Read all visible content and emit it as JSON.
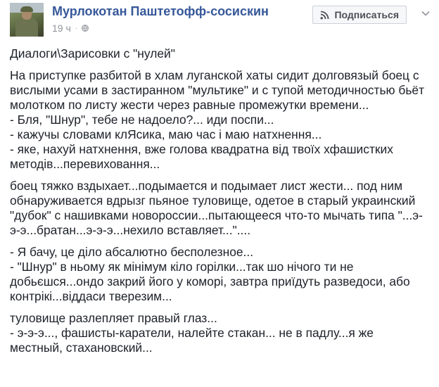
{
  "post": {
    "author": "Мурлокотан Паштетофф-сосискин",
    "time": "19 ч",
    "privacy_icon": "globe-icon",
    "follow_label": "Подписаться",
    "follow_icon": "rss-icon",
    "menu_icon": "chevron-down-icon"
  },
  "paragraphs": [
    {
      "lines": [
        "Диалоги\\Зарисовки с \"нулей\""
      ]
    },
    {
      "lines": [
        "На приступке разбитой в хлам луганской хаты сидит долговязый боец с",
        "вислыми усами в застиранном \"мультике\" и с тупой методичностью бьёт",
        "молотком по листу жести через равные промежутки времени...",
        "- Бля, \"Шнур\", тебе не надоело?... иди поспи...",
        "- кажучы словами клЯсика, маю час і маю натхнення...",
        "- яке, нахуй натхнення, вже голова квадратна від твоїх хфашистких",
        "методів...перевиховання..."
      ]
    },
    {
      "lines": [
        "боец тяжко вздыхает...подымается и подымает лист жести... под ним",
        "обнаруживается вдрызг пьяное туловище, одетое в старый украинский",
        "\"дубок\" с нашивками новороссии...пытающееся что-то мычать типа \"...э-",
        "э-э...братан...э-э-э...нехило вставляет...\"...."
      ]
    },
    {
      "lines": [
        "- Я бачу, це діло абсалютно бесполезное...",
        "- \"Шнур\" в ньому як мінімум кіло горілки...так шо нічого ти не",
        "добьєшся...ондо закрий його у коморі, завтра приїдуть разведоси, або",
        "контрікі...віддаси тверезим..."
      ]
    },
    {
      "lines": [
        "туловище разлепляет правый глаз...",
        "- э-э-э..., фашисты-каратели, налейте стакан... не в падлу...я же",
        "местный, стахановский..."
      ]
    }
  ]
}
